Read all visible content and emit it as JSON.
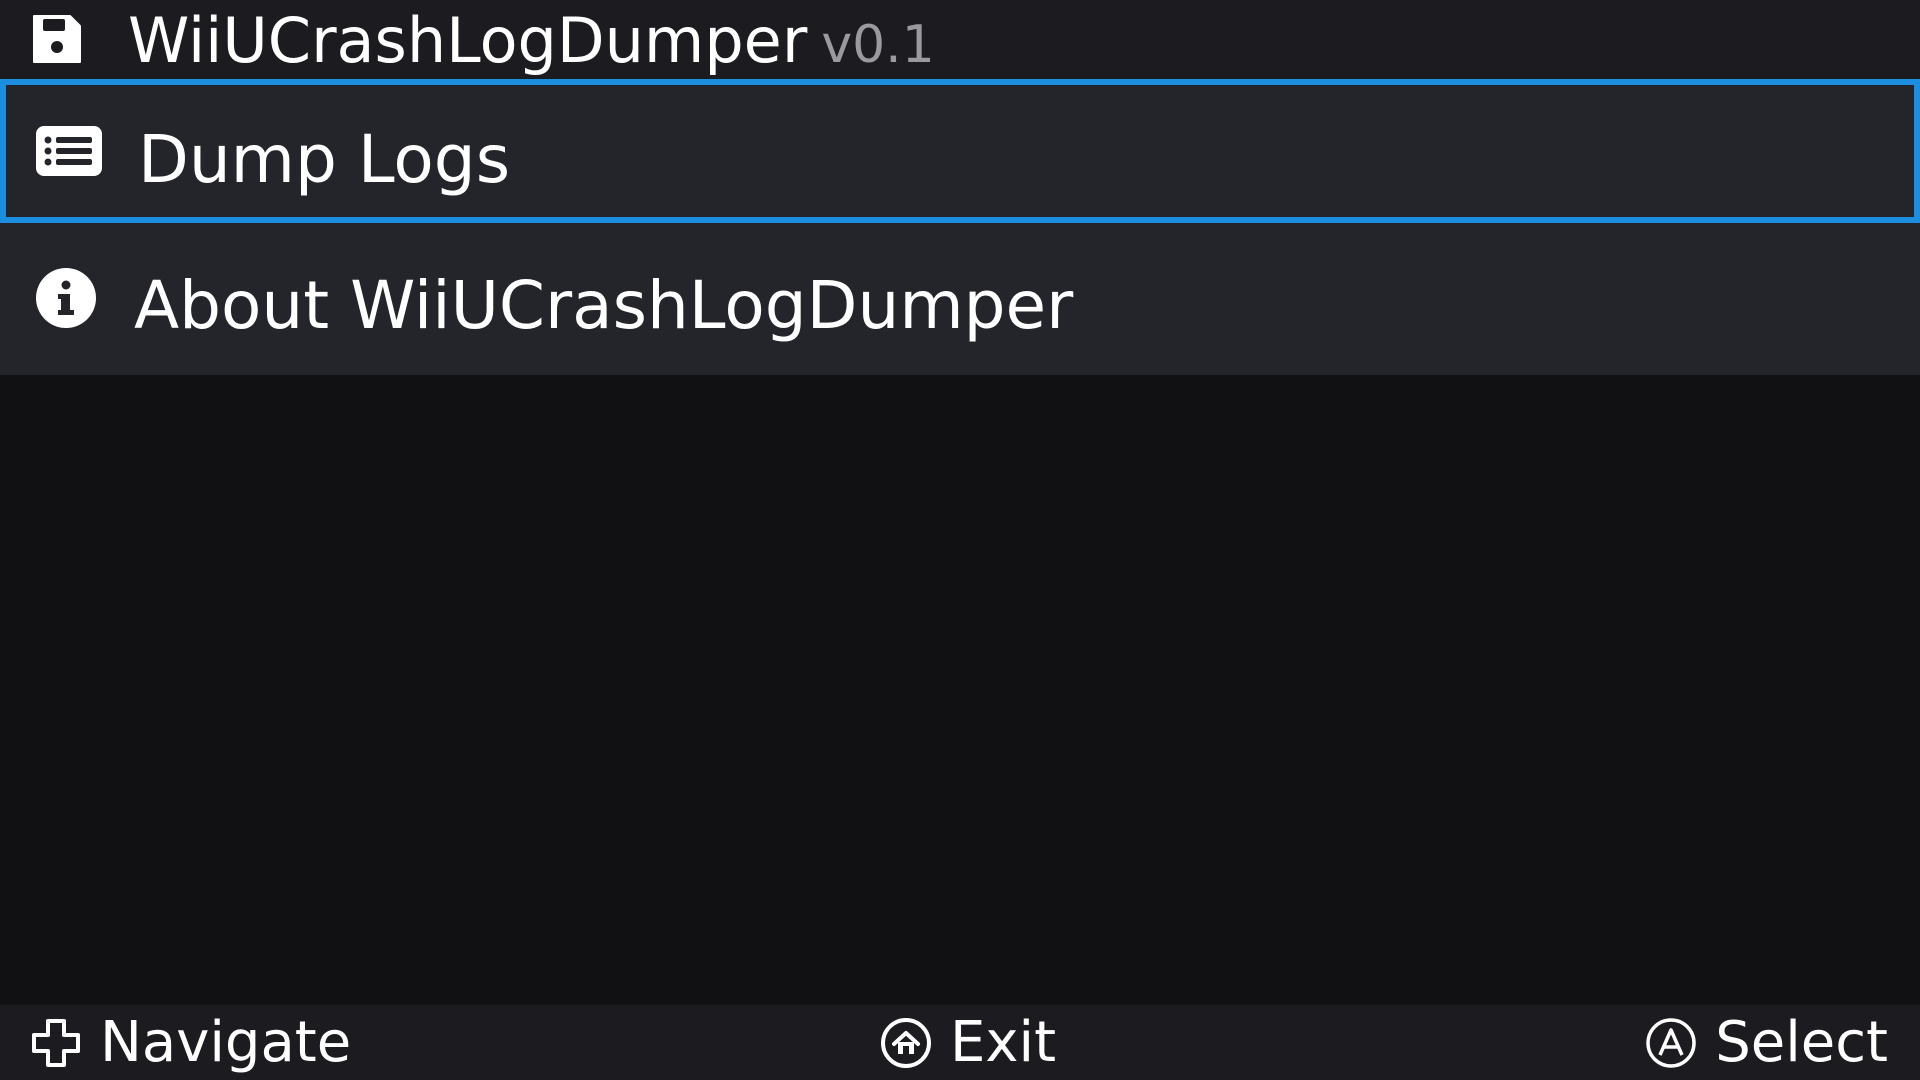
{
  "header": {
    "title": "WiiUCrashLogDumper",
    "version": "v0.1",
    "icon": "save-icon"
  },
  "menu": {
    "items": [
      {
        "label": "Dump Logs",
        "icon": "list-icon",
        "selected": true
      },
      {
        "label": "About WiiUCrashLogDumper",
        "icon": "info-icon",
        "selected": false
      }
    ]
  },
  "footer": {
    "hints": [
      {
        "label": "Navigate",
        "icon": "dpad-icon"
      },
      {
        "label": "Exit",
        "icon": "home-button-icon"
      },
      {
        "label": "Select",
        "icon": "a-button-icon"
      }
    ]
  },
  "colors": {
    "accent": "#1b8ee0",
    "background": "#111114",
    "panel": "#24252b",
    "bar": "#1c1c20",
    "version_text": "#9a9a9e"
  }
}
